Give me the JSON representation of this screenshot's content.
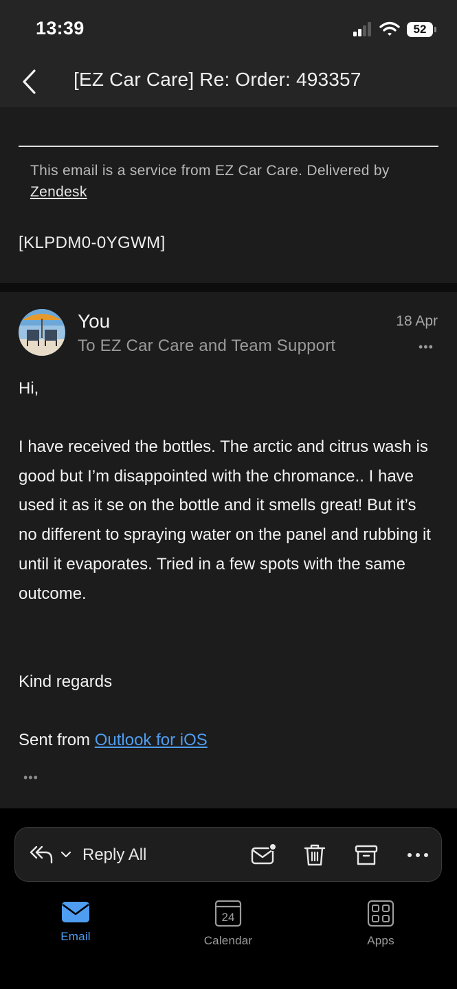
{
  "status_bar": {
    "time": "13:39",
    "battery": "52",
    "icons": [
      "cellular-signal-icon",
      "wifi-icon",
      "battery-icon"
    ]
  },
  "header": {
    "back_icon": "chevron-left-icon",
    "subject": "[EZ Car Care] Re: Order: 493357"
  },
  "previous_message": {
    "service_note": "This email is a service from EZ Car Care. Delivered by",
    "service_link": "Zendesk",
    "ticket_id": "[KLPDM0-0YGWM]"
  },
  "message": {
    "sender": "You",
    "recipients": "To EZ Car Care and Team Support",
    "date": "18 Apr",
    "more_icon": "ellipsis-icon",
    "greeting": "Hi,",
    "body": "I have received the bottles. The arctic and citrus wash is good but I’m disappointed with the chromance.. I have used it as it se on the bottle and it smells great! But it’s no different to spraying water on the panel and rubbing it until it evaporates. Tried in a few spots with the same outcome.",
    "closing": "Kind regards",
    "signature_prefix": "Sent from",
    "signature_link": "Outlook for iOS",
    "quoted_toggle": "•••"
  },
  "action_bar": {
    "reply_label": "Reply All",
    "icons": [
      "reply-all-icon",
      "chevron-down-icon",
      "mark-unread-icon",
      "trash-icon",
      "archive-icon",
      "more-icon"
    ]
  },
  "tabs": [
    {
      "label": "Email",
      "icon": "envelope-icon",
      "active": true
    },
    {
      "label": "Calendar",
      "icon": "calendar-icon",
      "day": "24",
      "active": false
    },
    {
      "label": "Apps",
      "icon": "apps-grid-icon",
      "active": false
    }
  ],
  "colors": {
    "accent": "#4f9df1",
    "background": "#1c1c1c",
    "header": "#252525"
  }
}
